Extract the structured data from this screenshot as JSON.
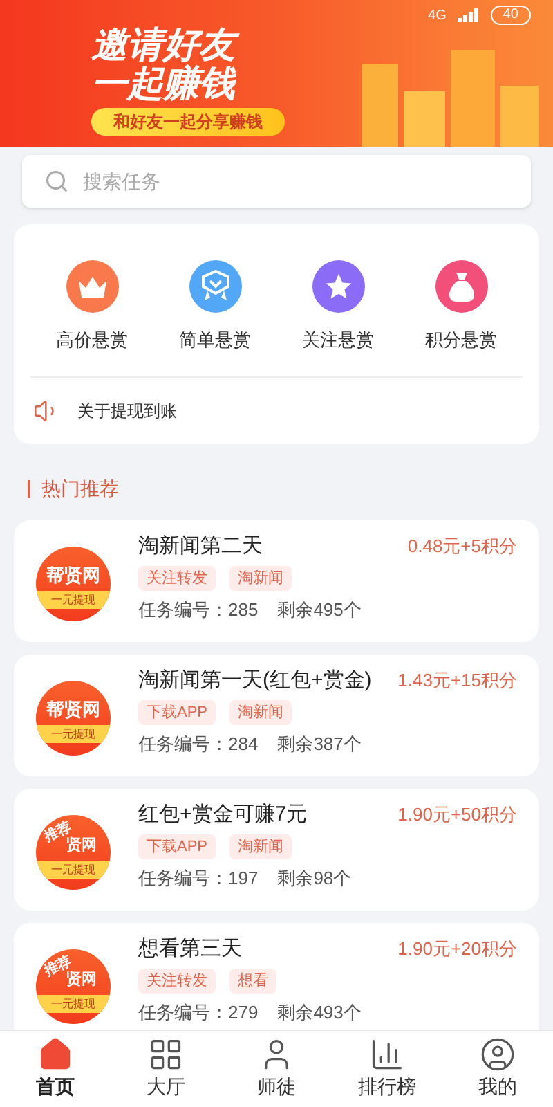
{
  "status_bar": {
    "network": "4G",
    "battery": "40"
  },
  "banner": {
    "title_lines": [
      "邀请好友",
      "一起赚钱"
    ],
    "subtitle": "和好友一起分享赚钱"
  },
  "search": {
    "placeholder": "搜索任务"
  },
  "categories": [
    {
      "label": "高价悬赏",
      "kind": "crown",
      "color": "#f9794c"
    },
    {
      "label": "简单悬赏",
      "kind": "badge",
      "color": "#52a8f7"
    },
    {
      "label": "关注悬赏",
      "kind": "star",
      "color": "#8b6cf6"
    },
    {
      "label": "积分悬赏",
      "kind": "bag",
      "color": "#f2507a"
    }
  ],
  "notice": {
    "text": "关于提现到账"
  },
  "section": {
    "title": "热门推荐"
  },
  "tasks": [
    {
      "logo": {
        "name": "帮贤网",
        "badge": "一元提现"
      },
      "title": "淘新闻第二天",
      "reward": "0.48元+5积分",
      "tags": [
        "关注转发",
        "淘新闻"
      ],
      "number_label": "任务编号：",
      "number": "285",
      "remaining": "剩余495个"
    },
    {
      "logo": {
        "name": "帮贤网",
        "badge": "一元提现"
      },
      "title": "淘新闻第一天(红包+赏金)",
      "reward": "1.43元+15积分",
      "tags": [
        "下载APP",
        "淘新闻"
      ],
      "number_label": "任务编号：",
      "number": "284",
      "remaining": "剩余387个"
    },
    {
      "logo": {
        "name": "贤网",
        "ribbon": "推荐",
        "badge": "一元提现"
      },
      "title": "红包+赏金可赚7元",
      "reward": "1.90元+50积分",
      "tags": [
        "下载APP",
        "淘新闻"
      ],
      "number_label": "任务编号：",
      "number": "197",
      "remaining": "剩余98个"
    },
    {
      "logo": {
        "name": "贤网",
        "ribbon": "推荐",
        "badge": "一元提现"
      },
      "title": "想看第三天",
      "reward": "1.90元+20积分",
      "tags": [
        "关注转发",
        "想看"
      ],
      "number_label": "任务编号：",
      "number": "279",
      "remaining": "剩余493个"
    }
  ],
  "nav": [
    {
      "label": "首页",
      "kind": "home",
      "selected": true
    },
    {
      "label": "大厅",
      "kind": "grid",
      "selected": false
    },
    {
      "label": "师徒",
      "kind": "user",
      "selected": false
    },
    {
      "label": "排行榜",
      "kind": "rank",
      "selected": false
    },
    {
      "label": "我的",
      "kind": "me",
      "selected": false
    }
  ]
}
